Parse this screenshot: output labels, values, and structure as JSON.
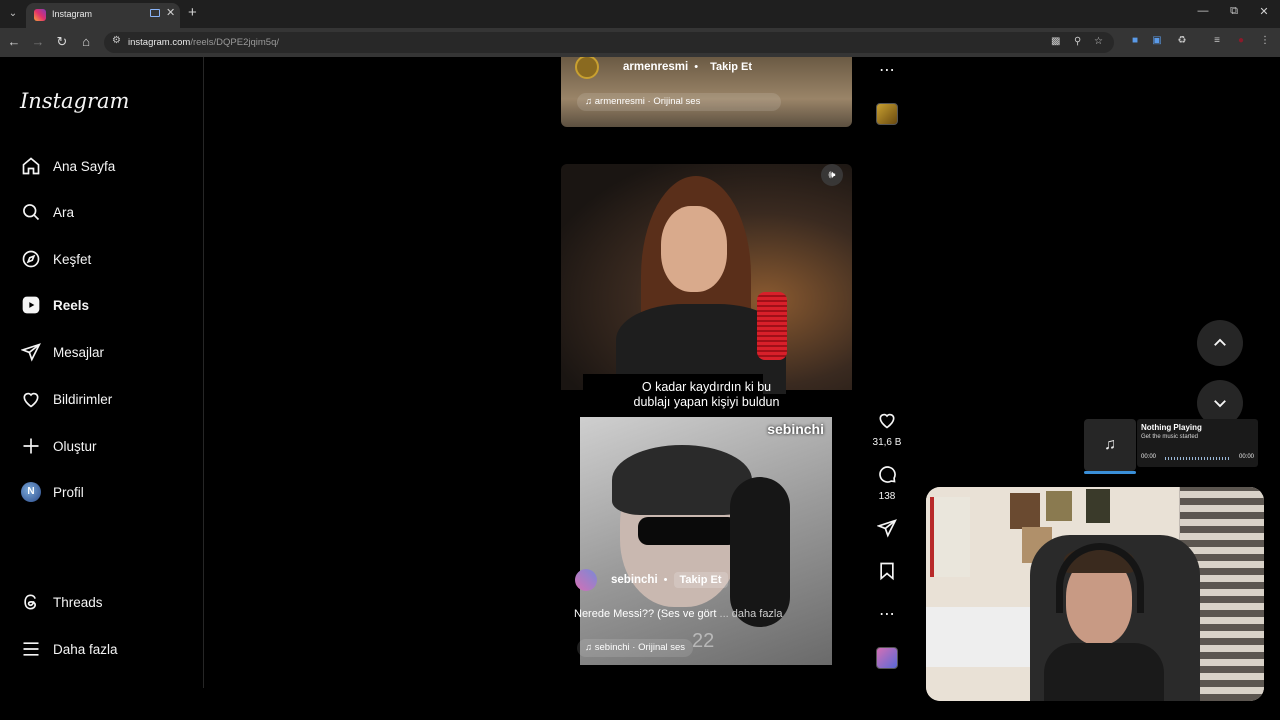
{
  "browser": {
    "tab_title": "Instagram",
    "url_host": "instagram.com",
    "url_path": "/reels/DQPE2jqim5q/"
  },
  "sidebar": {
    "logo": "Instagram",
    "items": [
      {
        "label": "Ana Sayfa",
        "icon": "home-icon"
      },
      {
        "label": "Ara",
        "icon": "search-icon"
      },
      {
        "label": "Keşfet",
        "icon": "compass-icon"
      },
      {
        "label": "Reels",
        "icon": "reels-icon"
      },
      {
        "label": "Mesajlar",
        "icon": "send-icon"
      },
      {
        "label": "Bildirimler",
        "icon": "heart-icon"
      },
      {
        "label": "Oluştur",
        "icon": "plus-icon"
      },
      {
        "label": "Profil",
        "icon": "avatar"
      }
    ],
    "bottom": [
      {
        "label": "Threads",
        "icon": "threads-icon"
      },
      {
        "label": "Daha fazla",
        "icon": "menu-icon"
      }
    ],
    "profile_initial": "N"
  },
  "previous_reel": {
    "author": "armenresmi",
    "follow": "Takip Et",
    "audio": "armenresmi · Orijinal ses"
  },
  "reel": {
    "caption_line1": "O kadar kaydırdın ki bu",
    "caption_line2": "dublajı yapan kişiyi buldun",
    "watermark": "sebinchi",
    "author": "sebinchi",
    "follow": "Takip Et",
    "description": "Nerede Messi?? (Ses ve gört",
    "description_more": " ... daha fazla",
    "audio": "sebinchi · Orijinal ses",
    "counter": "22",
    "likes": "31,6 B",
    "comments": "138"
  },
  "music_widget": {
    "title": "Nothing Playing",
    "subtitle": "Get the music started",
    "time_start": "00:00",
    "time_end": "00:00"
  },
  "colors": {
    "background": "#000000",
    "sidebar_border": "#262626",
    "accent_progress": "#3a8fd8"
  }
}
